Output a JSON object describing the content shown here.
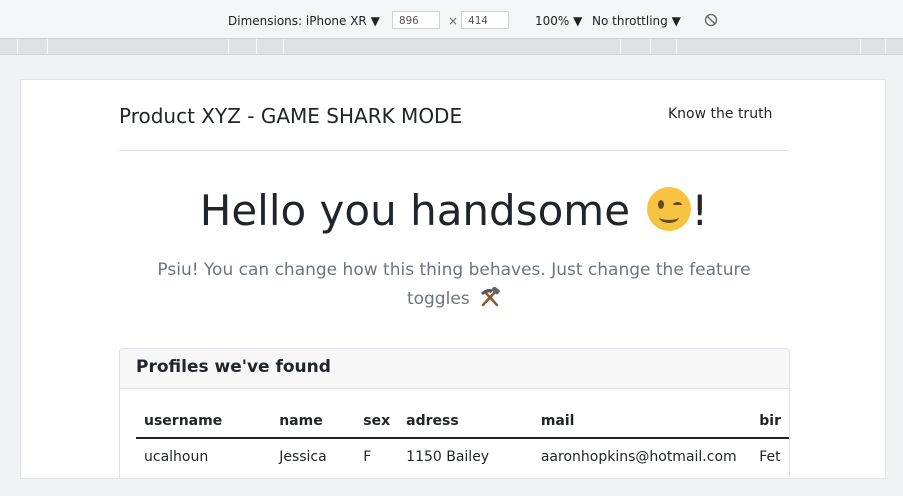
{
  "devtools": {
    "dimensions_label": "Dimensions: iPhone XR ▼",
    "width_value": "896",
    "height_value": "414",
    "times": "×",
    "zoom": "100% ▼",
    "throttling": "No throttling ▼"
  },
  "page": {
    "brand": "Product XYZ - GAME SHARK MODE",
    "nav_link": "Know the truth",
    "hero_title": "Hello you handsome",
    "hero_suffix": "!",
    "lead_text": "Psiu! You can change how this thing behaves. Just change the feature toggles"
  },
  "profiles": {
    "title": "Profiles we've found",
    "columns": [
      "username",
      "name",
      "sex",
      "adress",
      "mail",
      "bir"
    ],
    "rows": [
      [
        "ucalhoun",
        "Jessica",
        "F",
        "1150 Bailey",
        "aaronhopkins@hotmail.com",
        "Fet"
      ]
    ]
  },
  "colors": {
    "text": "#212529",
    "muted": "#6c757d",
    "border": "#dee2e6"
  }
}
